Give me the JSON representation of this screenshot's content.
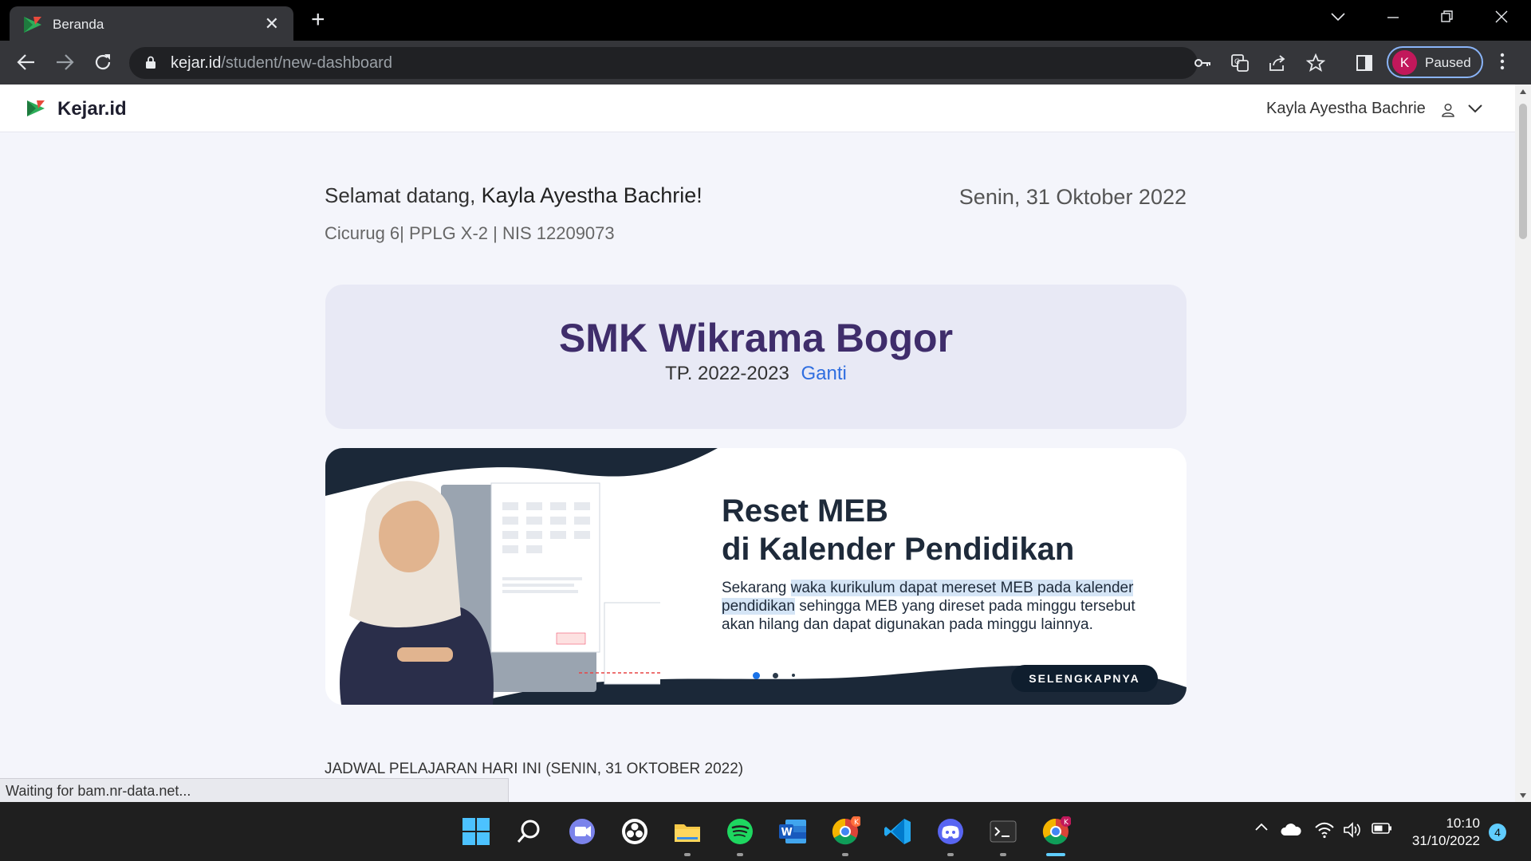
{
  "browser": {
    "tab_title": "Beranda",
    "tab_close": "✕",
    "new_tab": "+",
    "url_domain": "kejar.id",
    "url_path": "/student/new-dashboard",
    "profile_initial": "K",
    "profile_status": "Paused",
    "status_bar": "Waiting for bam.nr-data.net..."
  },
  "app": {
    "brand": "Kejar.id",
    "user_name": "Kayla Ayestha Bachrie"
  },
  "dashboard": {
    "welcome_prefix": "Selamat datang,",
    "welcome_name": "Kayla Ayestha Bachrie!",
    "date": "Senin, 31 Oktober 2022",
    "student_info": "Cicurug 6| PPLG X-2 | NIS 12209073",
    "school_name": "SMK Wikrama Bogor",
    "school_year": "TP. 2022-2023",
    "change_link": "Ganti",
    "schedule_heading": "JADWAL PELAJARAN HARI INI (SENIN, 31 OKTOBER 2022)"
  },
  "banner": {
    "title_line1": "Reset MEB",
    "title_line2": "di Kalender Pendidikan",
    "desc_part1": "Sekarang ",
    "desc_highlight1": "waka kurikulum dapat mereset MEB pada kalender",
    "desc_highlight2": "pendidikan",
    "desc_part2": " sehingga MEB yang direset pada minggu tersebut akan hilang dan dapat digunakan pada minggu lainnya.",
    "cta": "SELENGKAPNYA",
    "active_slide": 1,
    "slide_count": 3
  },
  "taskbar": {
    "time": "10:10",
    "date": "31/10/2022",
    "notification_count": "4",
    "chrome_badge_1": "K",
    "chrome_badge_2": "K"
  },
  "colors": {
    "brand_purple": "#3f2d6b",
    "link_blue": "#2f6ee0",
    "profile_pink": "#c2185b",
    "cta_navy": "#0f1e2e"
  }
}
